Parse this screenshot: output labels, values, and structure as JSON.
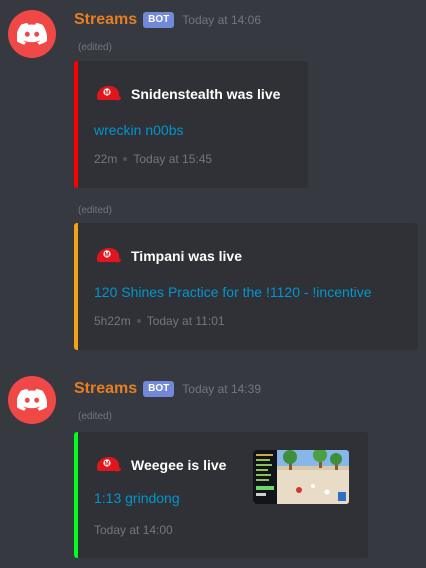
{
  "messages": [
    {
      "author": "Streams",
      "badge": "BOT",
      "timestamp": "Today at 14:06",
      "embeds": [
        {
          "edited": "(edited)",
          "accent": "#ff0000",
          "author_line": "Snidenstealth was live",
          "title": "wreckin n00bs",
          "footer_duration": "22m",
          "footer_time": "Today at 15:45"
        },
        {
          "edited": "(edited)",
          "accent": "#f5a21b",
          "author_line": "Timpani was live",
          "title": "120 Shines Practice for the !1120 - !incentive",
          "footer_duration": "5h22m",
          "footer_time": "Today at 11:01"
        }
      ]
    },
    {
      "author": "Streams",
      "badge": "BOT",
      "timestamp": "Today at 14:39",
      "embeds": [
        {
          "edited": "(edited)",
          "accent": "#00ff1e",
          "author_line": "Weegee is live",
          "title": "1:13 grindong",
          "footer_time": "Today at 14:00",
          "thumbnail": "stream-preview-image"
        }
      ]
    }
  ],
  "icons": {
    "avatar": "discord-logo-icon",
    "embed_author": "mario-cap-icon"
  },
  "colors": {
    "background": "#36393f",
    "embed_background": "#2f3136",
    "author_name": "#e67e22",
    "bot_badge": "#7289da",
    "link": "#0096cf",
    "avatar": "#f04747"
  }
}
